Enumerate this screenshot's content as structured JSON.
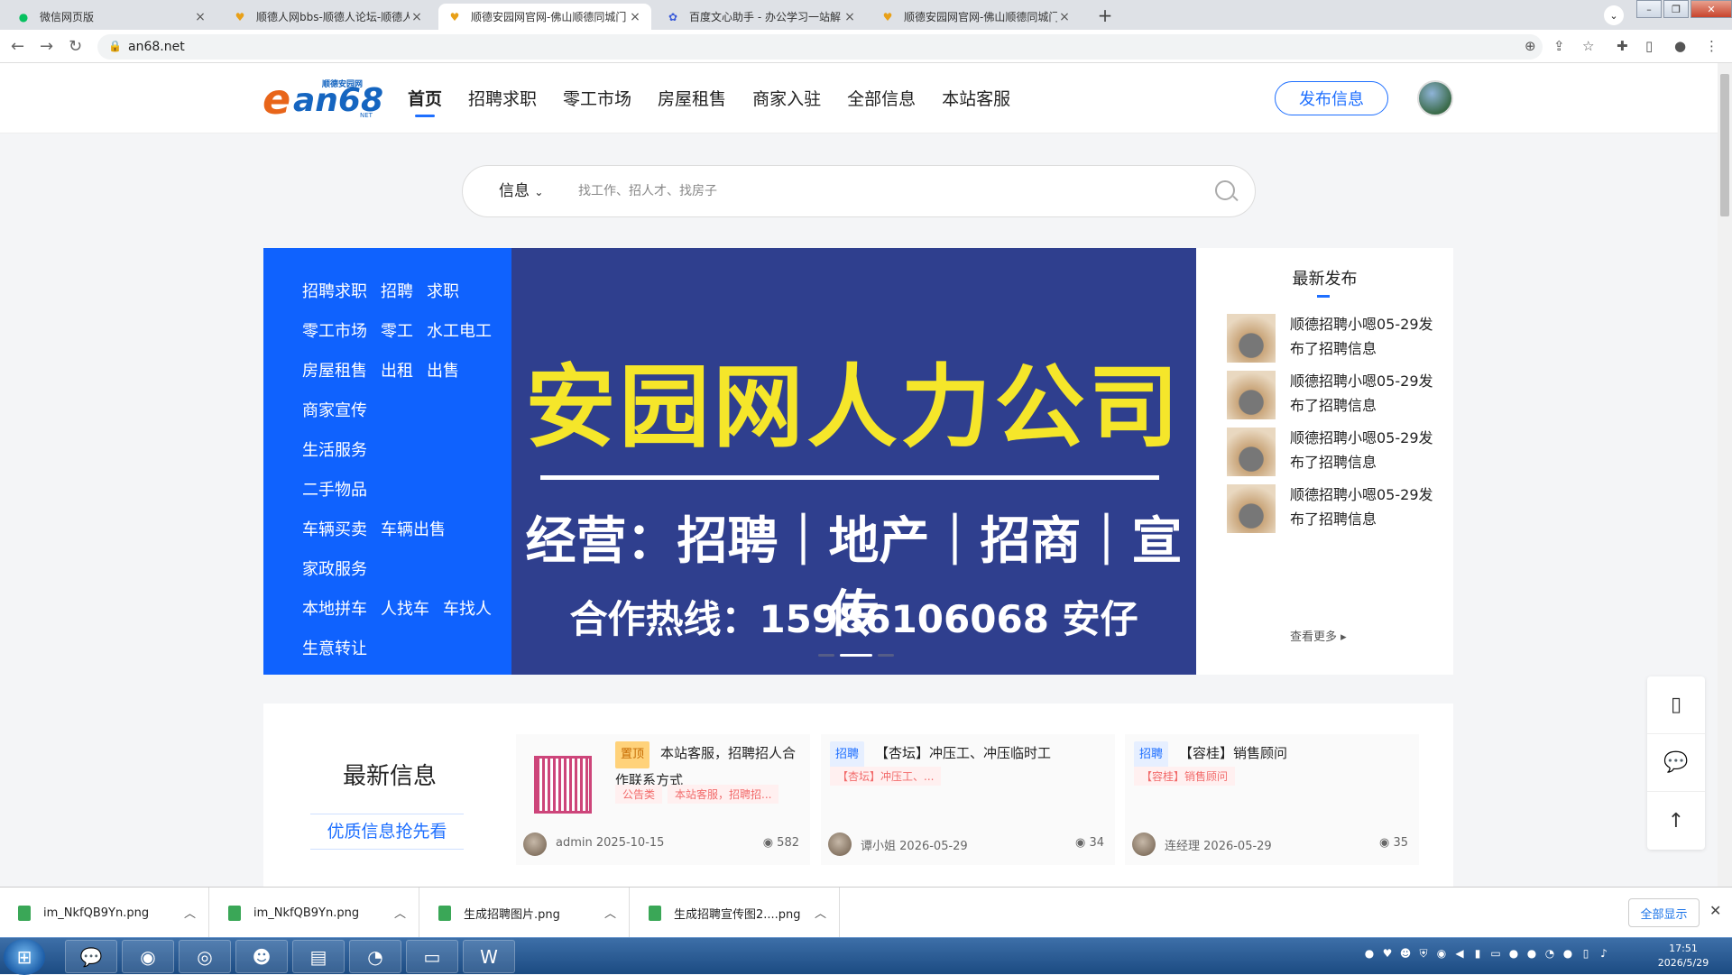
{
  "browser": {
    "tabs": [
      {
        "title": "微信网页版",
        "icon": "wechat-icon"
      },
      {
        "title": "顺德人网bbs-顺德人论坛-顺德人",
        "icon": "an68-icon"
      },
      {
        "title": "顺德安园网官网-佛山顺德同城门",
        "icon": "an68-icon"
      },
      {
        "title": "百度文心助手 - 办公学习一站解",
        "icon": "baidu-icon"
      },
      {
        "title": "顺德安园网官网-佛山顺德同城门",
        "icon": "an68-icon"
      }
    ],
    "active_tab": 2,
    "url": "an68.net"
  },
  "site": {
    "logo_sub": "顺德安园网",
    "logo_main": "an68",
    "logo_net": "NET",
    "nav": [
      "首页",
      "招聘求职",
      "零工市场",
      "房屋租售",
      "商家入驻",
      "全部信息",
      "本站客服"
    ],
    "nav_active": 0,
    "publish_label": "发布信息"
  },
  "search": {
    "category": "信息",
    "placeholder": "找工作、招人才、找房子"
  },
  "categories": [
    [
      "招聘求职",
      "招聘",
      "求职"
    ],
    [
      "零工市场",
      "零工",
      "水工电工"
    ],
    [
      "房屋租售",
      "出租",
      "出售"
    ],
    [
      "商家宣传"
    ],
    [
      "生活服务"
    ],
    [
      "二手物品"
    ],
    [
      "车辆买卖",
      "车辆出售"
    ],
    [
      "家政服务"
    ],
    [
      "本地拼车",
      "人找车",
      "车找人"
    ],
    [
      "生意转让"
    ]
  ],
  "banner": {
    "headline": "安园网人力公司",
    "business": "经营：招聘｜地产｜招商｜宣传",
    "hotline": "合作热线：15986106068 安仔",
    "slide_count": 3,
    "active_slide": 1
  },
  "latest": {
    "title": "最新发布",
    "items": [
      "顺德招聘小嗯05-29发布了招聘信息",
      "顺德招聘小嗯05-29发布了招聘信息",
      "顺德招聘小嗯05-29发布了招聘信息",
      "顺德招聘小嗯05-29发布了招聘信息"
    ],
    "more": "查看更多"
  },
  "info_section": {
    "title": "最新信息",
    "subtitle": "优质信息抢先看",
    "cards": [
      {
        "badge": "置顶",
        "title": "本站客服，招聘招人合作联系方式",
        "tags": [
          "公告类",
          "本站客服，招聘招..."
        ],
        "author": "admin",
        "date": "2025-10-15",
        "views": "582"
      },
      {
        "badge": "招聘",
        "title": "【杏坛】冲压工、冲压临时工",
        "tags": [
          "【杏坛】冲压工、..."
        ],
        "author": "谭小姐",
        "date": "2026-05-29",
        "views": "34"
      },
      {
        "badge": "招聘",
        "title": "【容桂】销售顾问",
        "tags": [
          "【容桂】销售顾问"
        ],
        "author": "连经理",
        "date": "2026-05-29",
        "views": "35"
      }
    ]
  },
  "downloads": {
    "files": [
      "im_NkfQB9Yn.png",
      "im_NkfQB9Yn.png",
      "生成招聘图片.png",
      "生成招聘宣传图2....png"
    ],
    "show_all": "全部显示"
  },
  "taskbar": {
    "time": "17:51",
    "date": "2026/5/29"
  },
  "colors": {
    "brand_blue": "#0f62fe",
    "banner_bg": "#2f3f8e",
    "banner_yellow": "#f5e62a",
    "top_badge": "#ffd27a",
    "recruit_badge": "#e6efff"
  }
}
